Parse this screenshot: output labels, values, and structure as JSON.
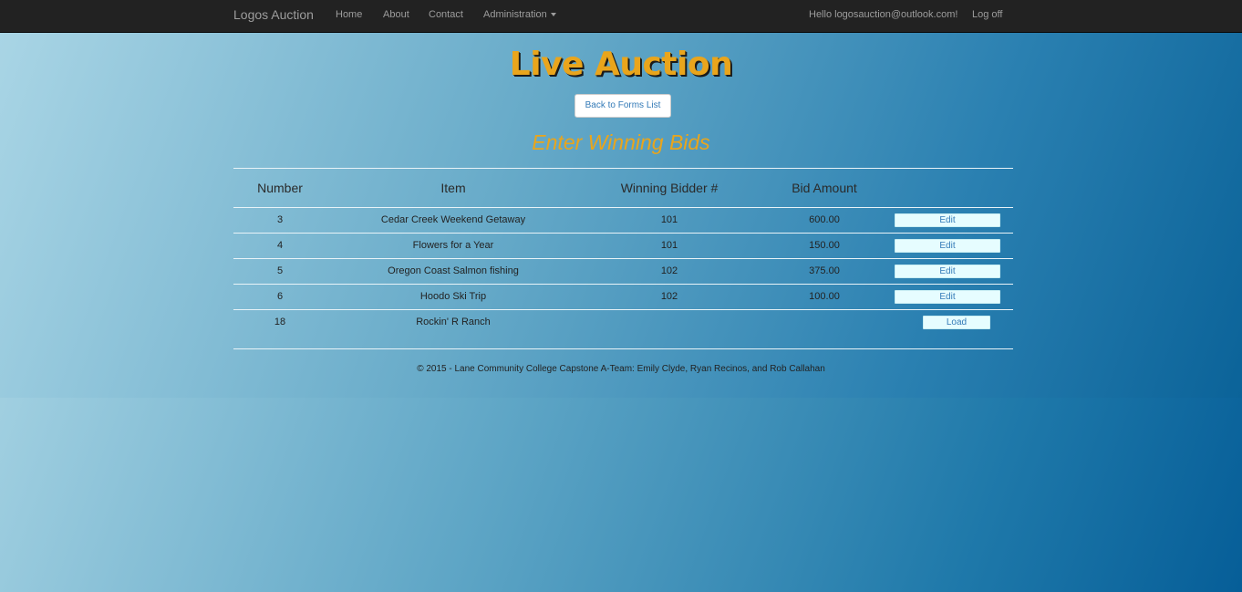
{
  "navbar": {
    "brand": "Logos Auction",
    "links": [
      "Home",
      "About",
      "Contact",
      "Administration"
    ],
    "greeting": "Hello logosauction@outlook.com!",
    "logoff": "Log off"
  },
  "page": {
    "title": "Live Auction",
    "back_button": "Back to Forms List",
    "subtitle": "Enter Winning Bids"
  },
  "table": {
    "headers": [
      "Number",
      "Item",
      "Winning Bidder #",
      "Bid Amount"
    ],
    "rows": [
      {
        "number": "3",
        "item": "Cedar Creek Weekend Getaway",
        "bidder": "101",
        "amount": "600.00",
        "action": "Edit"
      },
      {
        "number": "4",
        "item": "Flowers for a Year",
        "bidder": "101",
        "amount": "150.00",
        "action": "Edit"
      },
      {
        "number": "5",
        "item": "Oregon Coast Salmon fishing",
        "bidder": "102",
        "amount": "375.00",
        "action": "Edit"
      },
      {
        "number": "6",
        "item": "Hoodo Ski Trip",
        "bidder": "102",
        "amount": "100.00",
        "action": "Edit"
      },
      {
        "number": "18",
        "item": "Rockin' R Ranch",
        "bidder": "",
        "amount": "",
        "action": "Load"
      }
    ]
  },
  "footer": {
    "text": "© 2015 - Lane Community College Capstone A-Team: Emily Clyde, Ryan Recinos, and Rob Callahan"
  },
  "colors": {
    "navbar": "#222222",
    "title": "#e9a51c",
    "link": "#337ab7",
    "row_button": "#e6fdff"
  }
}
